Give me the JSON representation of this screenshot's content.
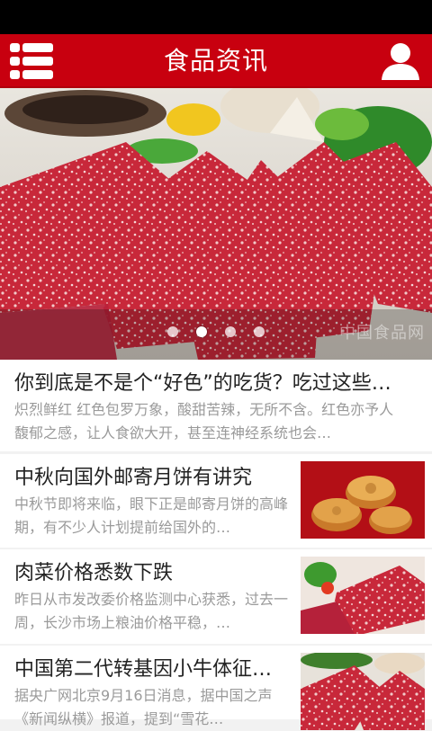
{
  "header": {
    "title": "食品资讯",
    "menu_icon": "list-menu-icon",
    "user_icon": "user-icon",
    "accent": "#c8000f"
  },
  "banner": {
    "slides": 4,
    "active_index": 1,
    "watermark": "中国食品网"
  },
  "news": [
    {
      "title": "你到底是不是个“好色”的吃货？吃过这些…",
      "desc": "炽烈鲜红 红色包罗万象，酸甜苦辣，无所不含。红色亦予人馥郁之感，让人食欲大开，甚至连神经系统也会…"
    },
    {
      "title": "中秋向国外邮寄月饼有讲究",
      "desc": "中秋节即将来临，眼下正是邮寄月饼的高峰期，有不少人计划提前给国外的…"
    },
    {
      "title": "肉菜价格悉数下跌",
      "desc": "昨日从市发改委价格监测中心获悉，过去一周，长沙市场上粮油价格平稳，…"
    },
    {
      "title": "中国第二代转基因小牛体征…",
      "desc": "据央广网北京9月16日消息，据中国之声《新闻纵横》报道，提到“雪花…"
    }
  ]
}
